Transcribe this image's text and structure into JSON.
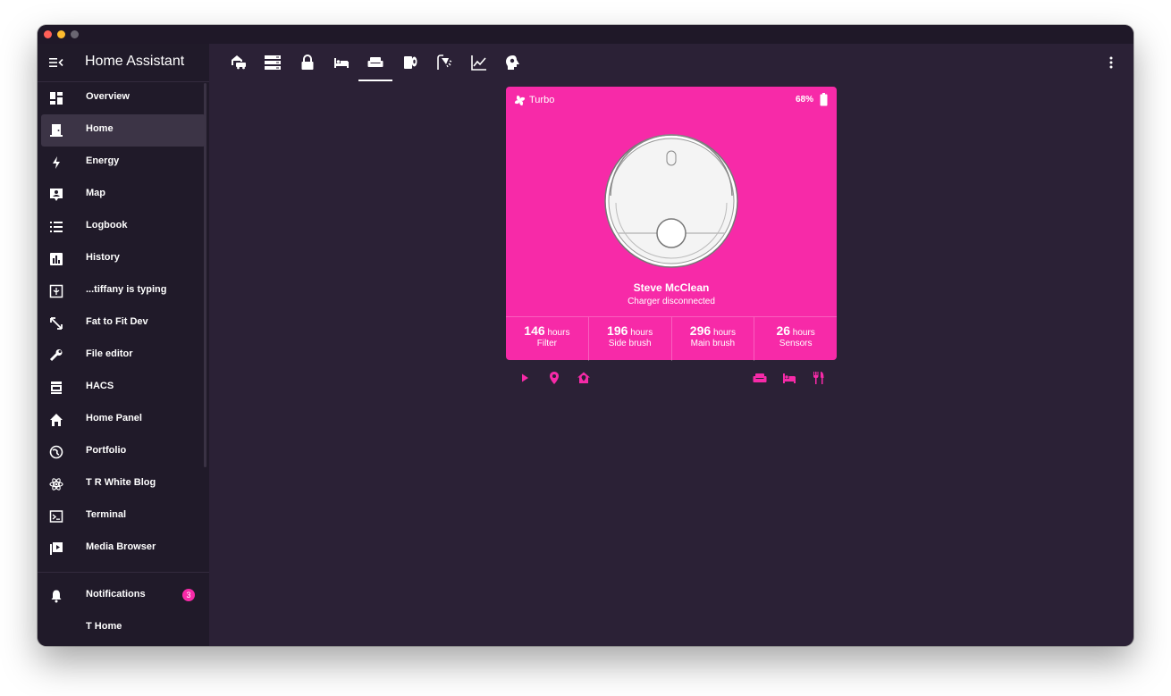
{
  "app": {
    "title": "Home Assistant"
  },
  "sidebar": {
    "items": [
      {
        "label": "Overview",
        "icon": "dashboard-icon"
      },
      {
        "label": "Home",
        "icon": "door-icon",
        "active": true
      },
      {
        "label": "Energy",
        "icon": "lightning-icon"
      },
      {
        "label": "Map",
        "icon": "map-account-icon"
      },
      {
        "label": "Logbook",
        "icon": "list-icon"
      },
      {
        "label": "History",
        "icon": "chart-box-icon"
      },
      {
        "label": "...tiffany is typing",
        "icon": "monitor-icon"
      },
      {
        "label": "Fat to Fit Dev",
        "icon": "arrows-diagonal-icon"
      },
      {
        "label": "File editor",
        "icon": "wrench-icon"
      },
      {
        "label": "HACS",
        "icon": "hacs-store-icon"
      },
      {
        "label": "Home Panel",
        "icon": "home-icon"
      },
      {
        "label": "Portfolio",
        "icon": "globe-icon"
      },
      {
        "label": "T R White Blog",
        "icon": "atom-icon"
      },
      {
        "label": "Terminal",
        "icon": "terminal-icon"
      },
      {
        "label": "Media Browser",
        "icon": "play-box-icon"
      }
    ],
    "notifications": {
      "label": "Notifications",
      "count": "3",
      "icon": "bell-icon"
    },
    "user": {
      "label": "T Home"
    }
  },
  "tabs": [
    {
      "icon": "home-car-icon"
    },
    {
      "icon": "server-icon"
    },
    {
      "icon": "lock-icon"
    },
    {
      "icon": "bed-icon"
    },
    {
      "icon": "sofa-icon",
      "active": true
    },
    {
      "icon": "toilet-paper-icon"
    },
    {
      "icon": "shower-icon"
    },
    {
      "icon": "chart-line-icon"
    },
    {
      "icon": "head-cog-icon"
    }
  ],
  "vacuum_card": {
    "fan_mode": "Turbo",
    "battery": "68%",
    "name": "Steve McClean",
    "status": "Charger disconnected",
    "stats": [
      {
        "value": "146",
        "unit": "hours",
        "label": "Filter"
      },
      {
        "value": "196",
        "unit": "hours",
        "label": "Side brush"
      },
      {
        "value": "296",
        "unit": "hours",
        "label": "Main brush"
      },
      {
        "value": "26",
        "unit": "hours",
        "label": "Sensors"
      }
    ],
    "actions_left": [
      "play-icon",
      "map-marker-icon",
      "home-map-marker-icon"
    ],
    "actions_right": [
      "sofa-icon",
      "bed-icon",
      "silverware-icon"
    ]
  },
  "colors": {
    "accent": "#f72aa8",
    "background": "#2b2136",
    "sidebar": "#201a29"
  }
}
